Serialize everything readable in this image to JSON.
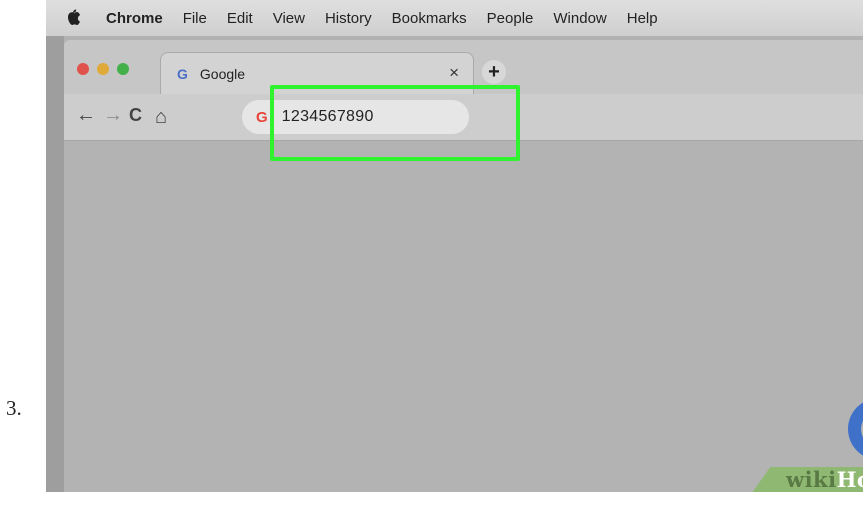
{
  "step": {
    "number": "3."
  },
  "menubar": {
    "apple_icon": "apple-logo-icon",
    "items": [
      "Chrome",
      "File",
      "Edit",
      "View",
      "History",
      "Bookmarks",
      "People",
      "Window",
      "Help"
    ]
  },
  "tab": {
    "favicon": "G",
    "title": "Google",
    "close": "×"
  },
  "new_tab": "+",
  "toolbar": {
    "back": "←",
    "forward": "→",
    "reload": "C",
    "home": "⌂"
  },
  "omnibox": {
    "favicon": "G",
    "value": "1234567890"
  },
  "watermark": {
    "part1": "wiki",
    "part2": "How"
  },
  "colors": {
    "highlight": "#2ff32f",
    "google_blue": "#3f71c9",
    "wikihow_green": "#8fb973"
  }
}
